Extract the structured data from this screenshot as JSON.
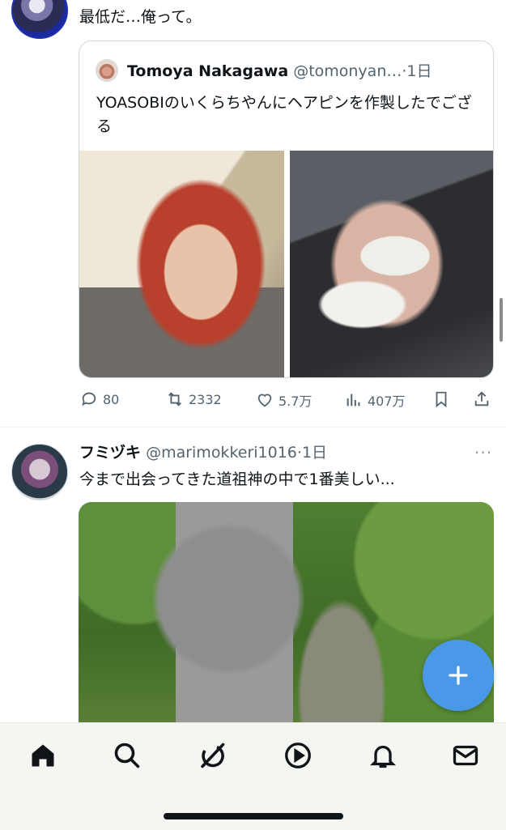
{
  "post1": {
    "text": "最低だ…俺って。",
    "quote": {
      "name": "Tomoya Nakagawa",
      "handle": "@tomonyan…",
      "separator": "·",
      "time": "1日",
      "text": "YOASOBIのいくらちやんにヘアピンを作製したでござる"
    },
    "actions": {
      "replies": "80",
      "reposts": "2332",
      "likes": "5.7万",
      "views": "407万"
    }
  },
  "post2": {
    "name": "フミヅキ",
    "handle": "@marimokkeri1016",
    "separator": "·",
    "time": "1日",
    "more": "···",
    "text": "今まで出会ってきた道祖神の中で1番美しい..."
  },
  "colors": {
    "accent": "#4a99e9",
    "muted_text": "#536471",
    "border": "#cfd9de"
  },
  "nav": {
    "items": [
      "home-icon",
      "search-icon",
      "grok-icon",
      "video-icon",
      "notifications-icon",
      "messages-icon"
    ]
  }
}
